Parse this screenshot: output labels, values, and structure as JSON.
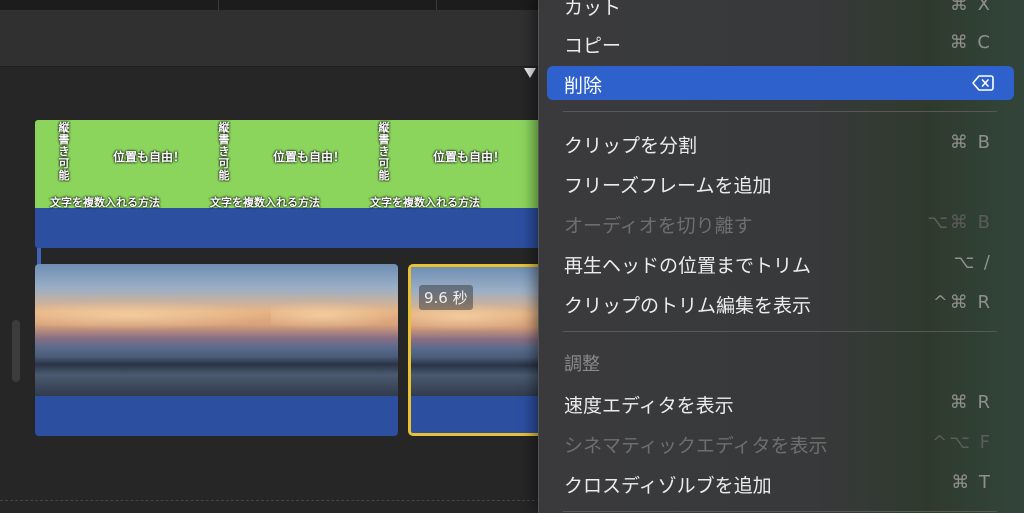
{
  "timeline": {
    "title_clip": {
      "segments": [
        {
          "vertical": "縦書き可能",
          "horizontal": "位置も自由！",
          "bottom": "文字を複数入れる方法"
        },
        {
          "vertical": "縦書き可能",
          "horizontal": "位置も自由！",
          "bottom": "文字を複数入れる方法"
        },
        {
          "vertical": "縦書き可能",
          "horizontal": "位置も自由！",
          "bottom": "文字を複数入れる方法"
        }
      ]
    },
    "clip2_duration": "9.6 秒"
  },
  "menu": {
    "items": [
      {
        "label": "カット",
        "shortcut": "⌘ X",
        "disabled": false
      },
      {
        "label": "コピー",
        "shortcut": "⌘ C",
        "disabled": false
      },
      {
        "label": "削除",
        "shortcut": "",
        "icon": "delete-key-icon",
        "highlighted": true
      },
      {
        "label": "クリップを分割",
        "shortcut": "⌘ B",
        "disabled": false
      },
      {
        "label": "フリーズフレームを追加",
        "shortcut": "",
        "disabled": false
      },
      {
        "label": "オーディオを切り離す",
        "shortcut": "⌥⌘ B",
        "disabled": true
      },
      {
        "label": "再生ヘッドの位置までトリム",
        "shortcut": "⌥ /",
        "disabled": false
      },
      {
        "label": "クリップのトリム編集を表示",
        "shortcut": "^⌘ R",
        "disabled": false
      },
      {
        "label": "速度エディタを表示",
        "shortcut": "⌘ R",
        "disabled": false
      },
      {
        "label": "シネマティックエディタを表示",
        "shortcut": "^⌥ F",
        "disabled": true
      },
      {
        "label": "クロスディゾルブを追加",
        "shortcut": "⌘ T",
        "disabled": false
      }
    ],
    "section_header": "調整"
  },
  "colors": {
    "highlight": "#2f61cd",
    "title_clip_green": "#8bd55d",
    "clip_blue": "#2c4fa0",
    "selection_yellow": "#e8c234"
  }
}
